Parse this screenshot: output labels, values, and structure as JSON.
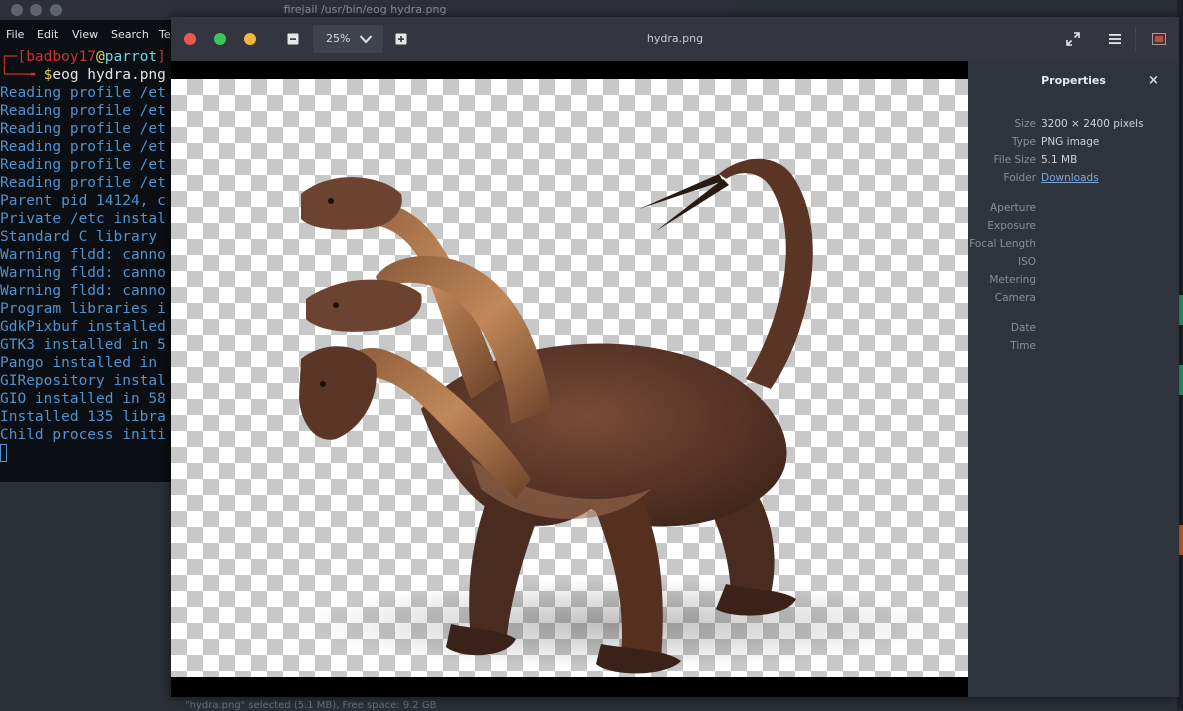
{
  "terminal": {
    "title": "firejail /usr/bin/eog hydra.png",
    "menu": [
      "File",
      "Edit",
      "View",
      "Search",
      "Te"
    ],
    "prompt_user": "badboy17",
    "prompt_at": "@",
    "prompt_host": "parrot",
    "command": "$eog hydra.png",
    "lines": [
      "Reading profile /et",
      "Reading profile /et",
      "Reading profile /et",
      "Reading profile /et",
      "Reading profile /et",
      "Reading profile /et",
      "Parent pid 14124, c",
      "Private /etc instal",
      "Standard C library ",
      "Warning fldd: canno",
      "Warning fldd: canno",
      "Warning fldd: canno",
      "Program libraries i",
      "GdkPixbuf installed",
      "GTK3 installed in 5",
      "Pango installed in ",
      "GIRepository instal",
      "GIO installed in 58",
      "Installed 135 libra",
      "Child process initi"
    ],
    "status_peek": "\"hydra.png\" selected (5.1 MB), Free space: 9.2 GB"
  },
  "viewer": {
    "title": "hydra.png",
    "zoom": "25%",
    "buttons": {
      "zoom_out": "zoom-out",
      "zoom_in": "zoom-in",
      "fullscreen": "fullscreen",
      "menu": "menu",
      "gallery": "gallery"
    },
    "colors": {
      "close": "#ee5550",
      "maximize": "#3bc55b",
      "minimize": "#f5b53a"
    },
    "properties": {
      "title": "Properties",
      "close": "×",
      "rows": [
        {
          "label": "Size",
          "value": "3200 × 2400 pixels"
        },
        {
          "label": "Type",
          "value": "PNG image"
        },
        {
          "label": "File Size",
          "value": "5.1 MB"
        },
        {
          "label": "Folder",
          "value": "Downloads"
        }
      ],
      "camera_rows": [
        {
          "label": "Aperture",
          "value": ""
        },
        {
          "label": "Exposure",
          "value": ""
        },
        {
          "label": "Focal Length",
          "value": ""
        },
        {
          "label": "ISO",
          "value": ""
        },
        {
          "label": "Metering",
          "value": ""
        },
        {
          "label": "Camera",
          "value": ""
        }
      ],
      "date_rows": [
        {
          "label": "Date",
          "value": ""
        },
        {
          "label": "Time",
          "value": ""
        }
      ]
    }
  }
}
